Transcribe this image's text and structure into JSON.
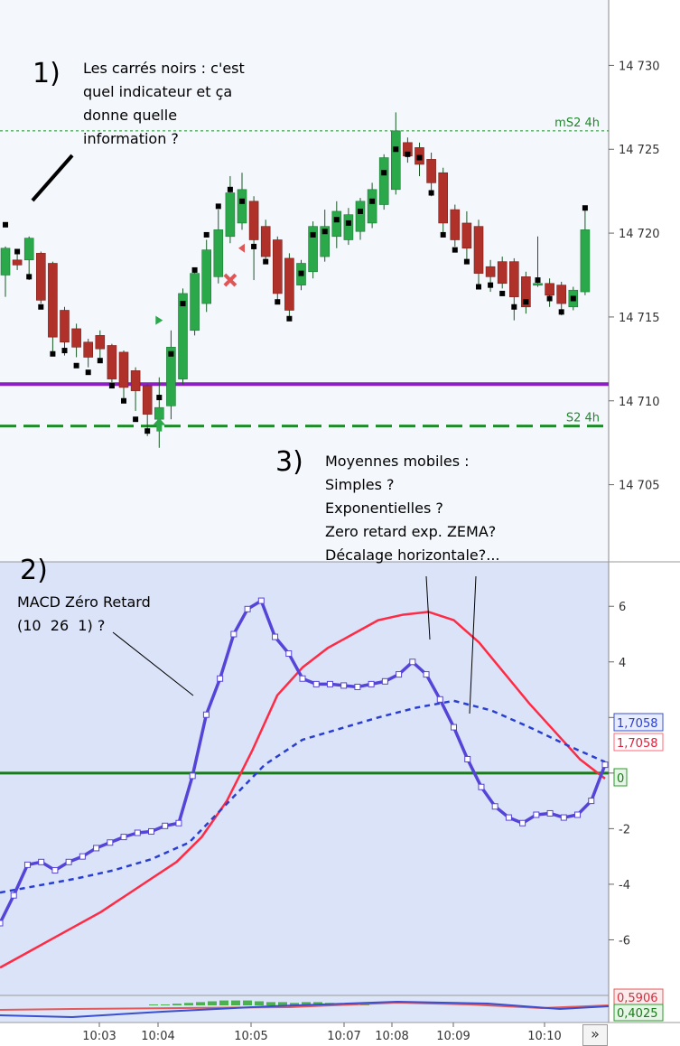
{
  "annotations": {
    "a1_number": "1)",
    "a1_text": "Les carrés noirs : c'est\nquel indicateur et ça\ndonne quelle\ninformation ?",
    "a2_number": "2)",
    "a2_text": "MACD Zéro Retard\n(10  26  1) ?",
    "a3_number": "3)",
    "a3_text": "Moyennes mobiles :\nSimples ?\nExponentielles ?\nZero retard exp. ZEMA?\nDécalage horizontale?..."
  },
  "nav_button": "»",
  "colors": {
    "bull": "#2aa84a",
    "bear": "#b0302a",
    "purple_line": "#8a1fc2",
    "support": "#1e8a2a",
    "macd": "#5544d8",
    "signal": "#ff2a44",
    "dashed_ma": "#2a3fd0",
    "zero": "#1a7a1a"
  },
  "chart_data": [
    {
      "type": "candlestick",
      "title": "",
      "y_ticks": [
        14730,
        14725,
        14720,
        14715,
        14710,
        14705
      ],
      "ylim": [
        14700.4,
        14733.9
      ],
      "levels": [
        {
          "name": "mS2 4h",
          "value": 14726.1,
          "style": "dotted"
        },
        {
          "name": "",
          "value": 14711,
          "style": "solid"
        },
        {
          "name": "S2 4h",
          "value": 14708.5,
          "style": "dashed"
        }
      ],
      "candles": [
        {
          "o": 14717.5,
          "h": 14719.2,
          "l": 14716.2,
          "c": 14719.1
        },
        {
          "o": 14718.4,
          "h": 14718.9,
          "l": 14717.8,
          "c": 14718.1
        },
        {
          "o": 14718.4,
          "h": 14719.8,
          "l": 14717.2,
          "c": 14719.7
        },
        {
          "o": 14718.8,
          "h": 14718.9,
          "l": 14715.8,
          "c": 14716.0
        },
        {
          "o": 14718.2,
          "h": 14718.3,
          "l": 14712.8,
          "c": 14713.8
        },
        {
          "o": 14715.4,
          "h": 14715.6,
          "l": 14712.7,
          "c": 14713.5
        },
        {
          "o": 14714.3,
          "h": 14714.6,
          "l": 14712.6,
          "c": 14713.2
        },
        {
          "o": 14713.5,
          "h": 14713.7,
          "l": 14712.0,
          "c": 14712.6
        },
        {
          "o": 14713.9,
          "h": 14714.2,
          "l": 14712.3,
          "c": 14713.1
        },
        {
          "o": 14713.3,
          "h": 14713.4,
          "l": 14711.1,
          "c": 14711.3
        },
        {
          "o": 14712.9,
          "h": 14713.0,
          "l": 14710.0,
          "c": 14710.8
        },
        {
          "o": 14711.8,
          "h": 14712.0,
          "l": 14709.4,
          "c": 14710.6
        },
        {
          "o": 14710.9,
          "h": 14711.0,
          "l": 14707.9,
          "c": 14709.2
        },
        {
          "o": 14708.9,
          "h": 14711.4,
          "l": 14707.2,
          "c": 14709.6
        },
        {
          "o": 14709.7,
          "h": 14714.2,
          "l": 14708.9,
          "c": 14713.2
        },
        {
          "o": 14711.3,
          "h": 14716.7,
          "l": 14711.0,
          "c": 14716.4
        },
        {
          "o": 14714.2,
          "h": 14717.9,
          "l": 14713.9,
          "c": 14717.6
        },
        {
          "o": 14715.8,
          "h": 14719.6,
          "l": 14715.3,
          "c": 14719.0
        },
        {
          "o": 14717.4,
          "h": 14721.4,
          "l": 14717.0,
          "c": 14720.2
        },
        {
          "o": 14719.8,
          "h": 14723.4,
          "l": 14719.4,
          "c": 14722.4
        },
        {
          "o": 14720.6,
          "h": 14723.6,
          "l": 14720.2,
          "c": 14722.6
        },
        {
          "o": 14721.9,
          "h": 14722.2,
          "l": 14717.2,
          "c": 14719.6
        },
        {
          "o": 14720.4,
          "h": 14720.8,
          "l": 14718.2,
          "c": 14718.6
        },
        {
          "o": 14719.6,
          "h": 14719.8,
          "l": 14715.8,
          "c": 14716.4
        },
        {
          "o": 14718.5,
          "h": 14718.8,
          "l": 14714.8,
          "c": 14715.4
        },
        {
          "o": 14716.9,
          "h": 14718.4,
          "l": 14716.6,
          "c": 14718.2
        },
        {
          "o": 14717.7,
          "h": 14720.7,
          "l": 14717.3,
          "c": 14720.4
        },
        {
          "o": 14718.6,
          "h": 14721.4,
          "l": 14718.3,
          "c": 14720.4
        },
        {
          "o": 14719.8,
          "h": 14721.9,
          "l": 14719.1,
          "c": 14721.3
        },
        {
          "o": 14719.6,
          "h": 14721.5,
          "l": 14719.3,
          "c": 14721.1
        },
        {
          "o": 14720.1,
          "h": 14722.1,
          "l": 14719.6,
          "c": 14721.9
        },
        {
          "o": 14720.6,
          "h": 14723.0,
          "l": 14720.3,
          "c": 14722.6
        },
        {
          "o": 14721.7,
          "h": 14724.7,
          "l": 14721.4,
          "c": 14724.5
        },
        {
          "o": 14722.6,
          "h": 14727.2,
          "l": 14722.3,
          "c": 14726.1
        },
        {
          "o": 14725.4,
          "h": 14725.7,
          "l": 14724.2,
          "c": 14724.6
        },
        {
          "o": 14725.1,
          "h": 14725.4,
          "l": 14723.4,
          "c": 14724.1
        },
        {
          "o": 14724.4,
          "h": 14724.8,
          "l": 14722.2,
          "c": 14723.0
        },
        {
          "o": 14723.6,
          "h": 14723.9,
          "l": 14719.8,
          "c": 14720.6
        },
        {
          "o": 14721.4,
          "h": 14721.7,
          "l": 14719.2,
          "c": 14719.6
        },
        {
          "o": 14720.6,
          "h": 14721.3,
          "l": 14718.3,
          "c": 14719.1
        },
        {
          "o": 14720.4,
          "h": 14720.8,
          "l": 14716.9,
          "c": 14717.6
        },
        {
          "o": 14718.0,
          "h": 14718.4,
          "l": 14716.5,
          "c": 14717.4
        },
        {
          "o": 14718.3,
          "h": 14718.6,
          "l": 14716.7,
          "c": 14717.0
        },
        {
          "o": 14718.3,
          "h": 14718.5,
          "l": 14714.8,
          "c": 14716.2
        },
        {
          "o": 14717.4,
          "h": 14717.7,
          "l": 14715.2,
          "c": 14715.6
        },
        {
          "o": 14716.9,
          "h": 14719.8,
          "l": 14716.8,
          "c": 14717.0
        },
        {
          "o": 14717.0,
          "h": 14717.3,
          "l": 14715.6,
          "c": 14716.3
        },
        {
          "o": 14716.9,
          "h": 14717.1,
          "l": 14715.1,
          "c": 14715.8
        },
        {
          "o": 14715.6,
          "h": 14716.8,
          "l": 14715.4,
          "c": 14716.6
        },
        {
          "o": 14716.5,
          "h": 14721.6,
          "l": 14716.3,
          "c": 14720.2
        }
      ],
      "black_square_markers": [
        14720.5,
        14718.9,
        14717.4,
        14715.6,
        14712.8,
        14713.0,
        14712.1,
        14711.7,
        14712.4,
        14710.9,
        14710.0,
        14708.9,
        14708.2,
        14710.2,
        14712.8,
        14715.8,
        14717.8,
        14719.9,
        14721.6,
        14722.6,
        14721.9,
        14719.2,
        14718.3,
        14715.9,
        14714.9,
        14717.6,
        14719.9,
        14720.1,
        14720.8,
        14720.6,
        14721.3,
        14721.9,
        14723.6,
        14725.0,
        14724.7,
        14724.5,
        14722.4,
        14719.9,
        14719.0,
        14718.3,
        14716.8,
        14716.9,
        14716.4,
        14715.6,
        14715.9,
        14717.2,
        14716.1,
        14715.3,
        14716.1,
        14721.5
      ],
      "signals": [
        {
          "type": "up-arrow",
          "at": 13,
          "value": 14708.5
        },
        {
          "type": "right-triangle",
          "at": 13,
          "value": 14714.8
        },
        {
          "type": "cross",
          "at": 19,
          "value": 14717.2
        },
        {
          "type": "triangle",
          "at": 20,
          "value": 14719.1
        }
      ]
    },
    {
      "type": "line",
      "title": "",
      "y_ticks": [
        6,
        4,
        2,
        0,
        -2,
        -4,
        -6
      ],
      "ylim": [
        -8.0,
        7.6
      ],
      "readouts": [
        "1,7058",
        "1,7058",
        "0"
      ],
      "x_ticks": [
        "10:03",
        "10:04",
        "10:05",
        "10:07",
        "10:08",
        "10:09",
        "10:10"
      ],
      "series": [
        {
          "name": "",
          "style": "solid-markers",
          "values": [
            -5.4,
            -4.4,
            -3.3,
            -3.2,
            -3.5,
            -3.2,
            -3.0,
            -2.7,
            -2.5,
            -2.3,
            -2.15,
            -2.1,
            -1.9,
            -1.8,
            -0.1,
            2.1,
            3.4,
            5.0,
            5.9,
            6.2,
            4.9,
            4.3,
            3.4,
            3.2,
            3.2,
            3.15,
            3.1,
            3.2,
            3.3,
            3.55,
            4.0,
            3.55,
            2.65,
            1.65,
            0.5,
            -0.5,
            -1.2,
            -1.6,
            -1.8,
            -1.5,
            -1.45,
            -1.6,
            -1.5,
            -1.0,
            0.3
          ]
        },
        {
          "name": "",
          "style": "solid",
          "values": [
            -7.0,
            -6.5,
            -6.0,
            -5.5,
            -5.0,
            -4.4,
            -3.8,
            -3.2,
            -2.3,
            -1.0,
            0.8,
            2.8,
            3.8,
            4.5,
            5.0,
            5.5,
            5.7,
            5.8,
            5.5,
            4.7,
            3.6,
            2.5,
            1.5,
            0.5,
            -0.2
          ]
        },
        {
          "name": "",
          "style": "dashed",
          "values": [
            -4.3,
            -4.05,
            -3.8,
            -3.5,
            -3.1,
            -2.5,
            -1.1,
            0.3,
            1.2,
            1.6,
            2.0,
            2.35,
            2.6,
            2.25,
            1.65,
            1.0,
            0.4
          ]
        }
      ]
    },
    {
      "type": "bar",
      "title": "",
      "readouts": [
        "0,5906",
        "0,4025"
      ],
      "values": [
        0.0,
        0.05,
        0.1,
        0.15,
        0.2,
        0.25,
        0.3,
        0.3,
        0.3,
        0.25,
        0.2,
        0.2,
        0.15,
        0.2,
        0.2,
        0.15,
        0.1,
        0.05,
        0.05
      ]
    }
  ]
}
